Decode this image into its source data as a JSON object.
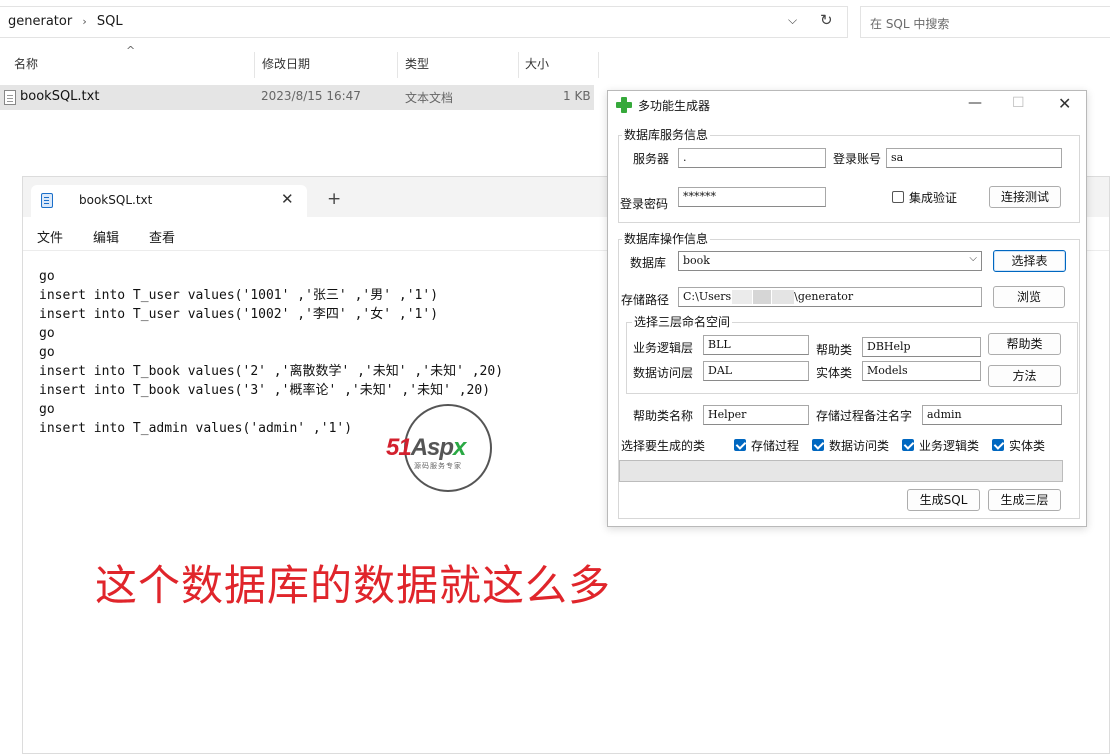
{
  "explorer": {
    "breadcrumb": [
      "generator",
      "SQL"
    ],
    "search_placeholder": "在 SQL 中搜索",
    "columns": [
      "名称",
      "修改日期",
      "类型",
      "大小"
    ],
    "files": [
      {
        "name": "bookSQL.txt",
        "modified": "2023/8/15 16:47",
        "type": "文本文档",
        "size": "1 KB"
      }
    ]
  },
  "notepad": {
    "tab_title": "bookSQL.txt",
    "menu": [
      "文件",
      "编辑",
      "查看"
    ],
    "lines": [
      "go",
      "insert into T_user values('1001' ,'张三' ,'男' ,'1')",
      "insert into T_user values('1002' ,'李四' ,'女' ,'1')",
      "go",
      "go",
      "insert into T_book values('2' ,'离散数学' ,'未知' ,'未知' ,20)",
      "insert into T_book values('3' ,'概率论' ,'未知' ,'未知' ,20)",
      "go",
      "insert into T_admin values('admin' ,'1')"
    ]
  },
  "watermark": {
    "logo_text": "51Aspx",
    "subtitle": "源码服务专家"
  },
  "annotation": "这个数据库的数据就这么多",
  "dialog": {
    "title": "多功能生成器",
    "server_group": {
      "title": "数据库服务信息",
      "server_label": "服务器",
      "server_value": ".",
      "account_label": "登录账号",
      "account_value": "sa",
      "password_label": "登录密码",
      "password_value": "******",
      "integrated_label": "集成验证",
      "integrated_checked": false,
      "test_button": "连接测试"
    },
    "ops_group": {
      "title": "数据库操作信息",
      "database_label": "数据库",
      "database_value": "book",
      "select_table_button": "选择表",
      "path_label": "存储路径",
      "path_prefix": "C:\\Users",
      "path_suffix": "\\generator",
      "browse_button": "浏览"
    },
    "ns_group": {
      "title": "选择三层命名空间",
      "bll_label": "业务逻辑层",
      "bll_value": "BLL",
      "helper_label": "帮助类",
      "helper_value": "DBHelp",
      "helper_button": "帮助类",
      "dal_label": "数据访问层",
      "dal_value": "DAL",
      "entity_label": "实体类",
      "entity_value": "Models",
      "method_button": "方法"
    },
    "helper_class_label": "帮助类名称",
    "helper_class_value": "Helper",
    "proc_note_label": "存储过程备注名字",
    "proc_note_value": "admin",
    "generate_label": "选择要生成的类",
    "options": [
      {
        "label": "存储过程",
        "checked": true
      },
      {
        "label": "数据访问类",
        "checked": true
      },
      {
        "label": "业务逻辑类",
        "checked": true
      },
      {
        "label": "实体类",
        "checked": true
      }
    ],
    "progress": 0,
    "gen_sql_button": "生成SQL",
    "gen_three_button": "生成三层"
  }
}
